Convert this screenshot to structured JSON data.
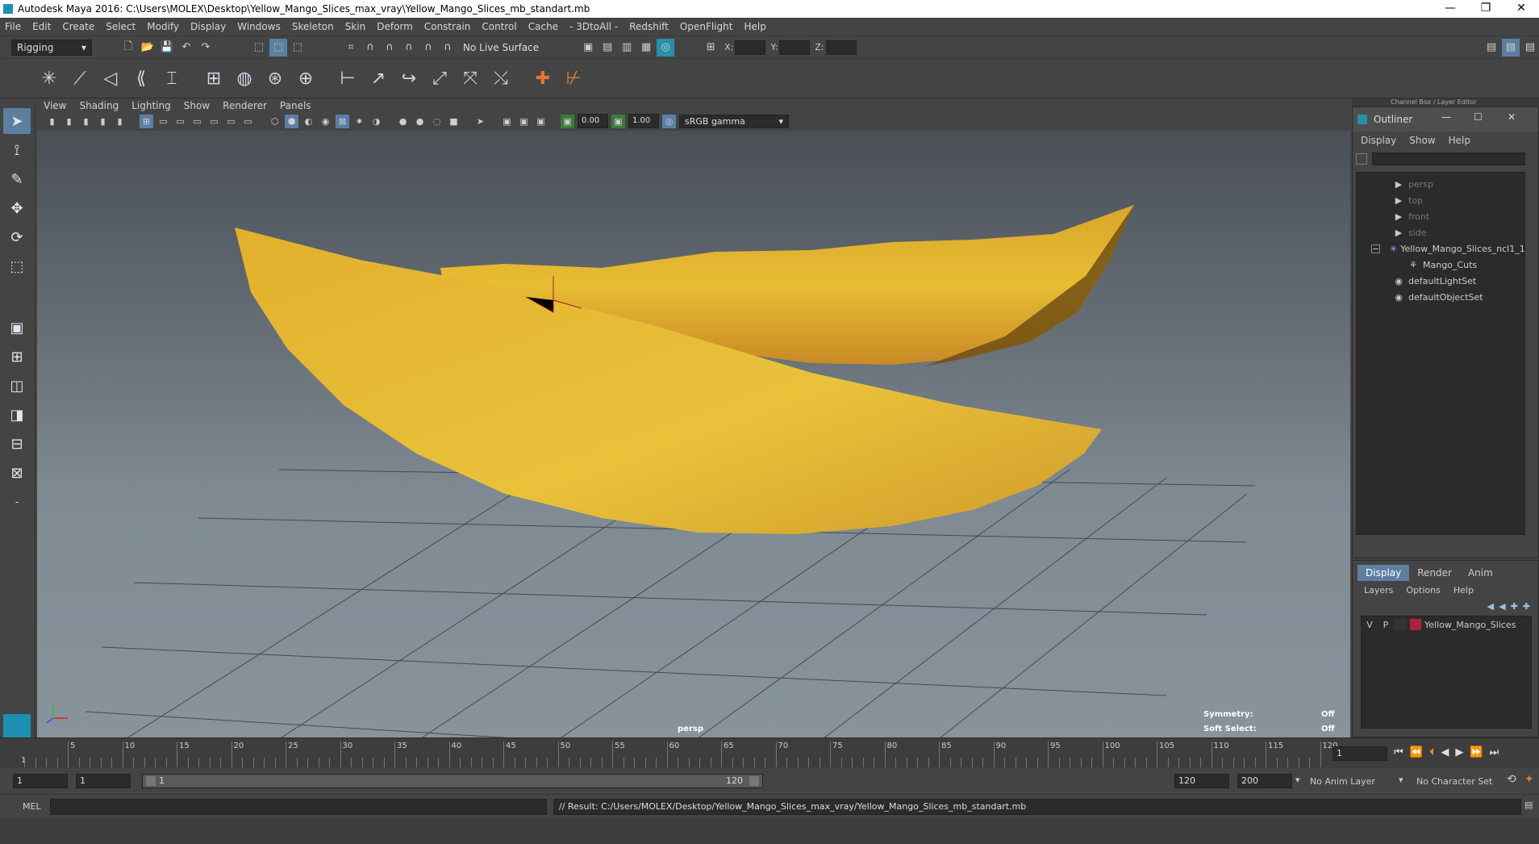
{
  "window": {
    "title": "Autodesk Maya 2016: C:\\Users\\MOLEX\\Desktop\\Yellow_Mango_Slices_max_vray\\Yellow_Mango_Slices_mb_standart.mb",
    "minimize": "—",
    "restore": "❐",
    "close": "✕"
  },
  "menubar": [
    "File",
    "Edit",
    "Create",
    "Select",
    "Modify",
    "Display",
    "Windows",
    "Skeleton",
    "Skin",
    "Deform",
    "Constrain",
    "Control",
    "Cache",
    "- 3DtoAll -",
    "Redshift",
    "OpenFlight",
    "Help"
  ],
  "status": {
    "menuset": "Rigging",
    "live_surface": "No Live Surface",
    "x_label": "X:",
    "y_label": "Y:",
    "z_label": "Z:"
  },
  "panel": {
    "menus": [
      "View",
      "Shading",
      "Lighting",
      "Show",
      "Renderer",
      "Panels"
    ],
    "exposure": "0.00",
    "gamma": "1.00",
    "colorspace": "sRGB gamma"
  },
  "viewport": {
    "camera": "persp",
    "symmetry_label": "Symmetry:",
    "symmetry_value": "Off",
    "softselect_label": "Soft Select:",
    "softselect_value": "Off",
    "channelbox_title": "Channel Box / Layer Editor"
  },
  "outliner": {
    "title": "Outliner",
    "menus": [
      "Display",
      "Show",
      "Help"
    ],
    "items": [
      {
        "label": "persp",
        "icon": "camera-icon",
        "dim": true,
        "indent": 0
      },
      {
        "label": "top",
        "icon": "camera-icon",
        "dim": true,
        "indent": 0
      },
      {
        "label": "front",
        "icon": "camera-icon",
        "dim": true,
        "indent": 0
      },
      {
        "label": "side",
        "icon": "camera-icon",
        "dim": true,
        "indent": 0
      },
      {
        "label": "Yellow_Mango_Slices_ncl1_1",
        "icon": "group-icon",
        "dim": false,
        "indent": 0
      },
      {
        "label": "Mango_Cuts",
        "icon": "mesh-icon",
        "dim": false,
        "indent": 1
      },
      {
        "label": "defaultLightSet",
        "icon": "set-icon",
        "dim": false,
        "indent": 0
      },
      {
        "label": "defaultObjectSet",
        "icon": "set-icon",
        "dim": false,
        "indent": 0
      }
    ]
  },
  "layers": {
    "tabs": [
      "Display",
      "Render",
      "Anim"
    ],
    "menus": [
      "Layers",
      "Options",
      "Help"
    ],
    "row": {
      "v": "V",
      "p": "P",
      "name": "Yellow_Mango_Slices",
      "color": "#b0213a"
    }
  },
  "timeline": {
    "ticks": [
      "5",
      "10",
      "15",
      "20",
      "25",
      "30",
      "35",
      "40",
      "45",
      "50",
      "55",
      "60",
      "65",
      "70",
      "75",
      "80",
      "85",
      "90",
      "95",
      "100",
      "105",
      "110",
      "115",
      "120"
    ],
    "start_tick": "1",
    "current_frame": "1"
  },
  "range": {
    "start": "1",
    "anim_start": "1",
    "slider_start": "1",
    "slider_end": "120",
    "end": "120",
    "anim_end": "200",
    "anim_layer": "No Anim Layer",
    "char_set": "No Character Set"
  },
  "cmd": {
    "mode": "MEL",
    "result": "// Result: C:/Users/MOLEX/Desktop/Yellow_Mango_Slices_max_vray/Yellow_Mango_Slices_mb_standart.mb"
  },
  "colors": {
    "accent": "#5d7f9f",
    "mango": "#e6b52e"
  }
}
